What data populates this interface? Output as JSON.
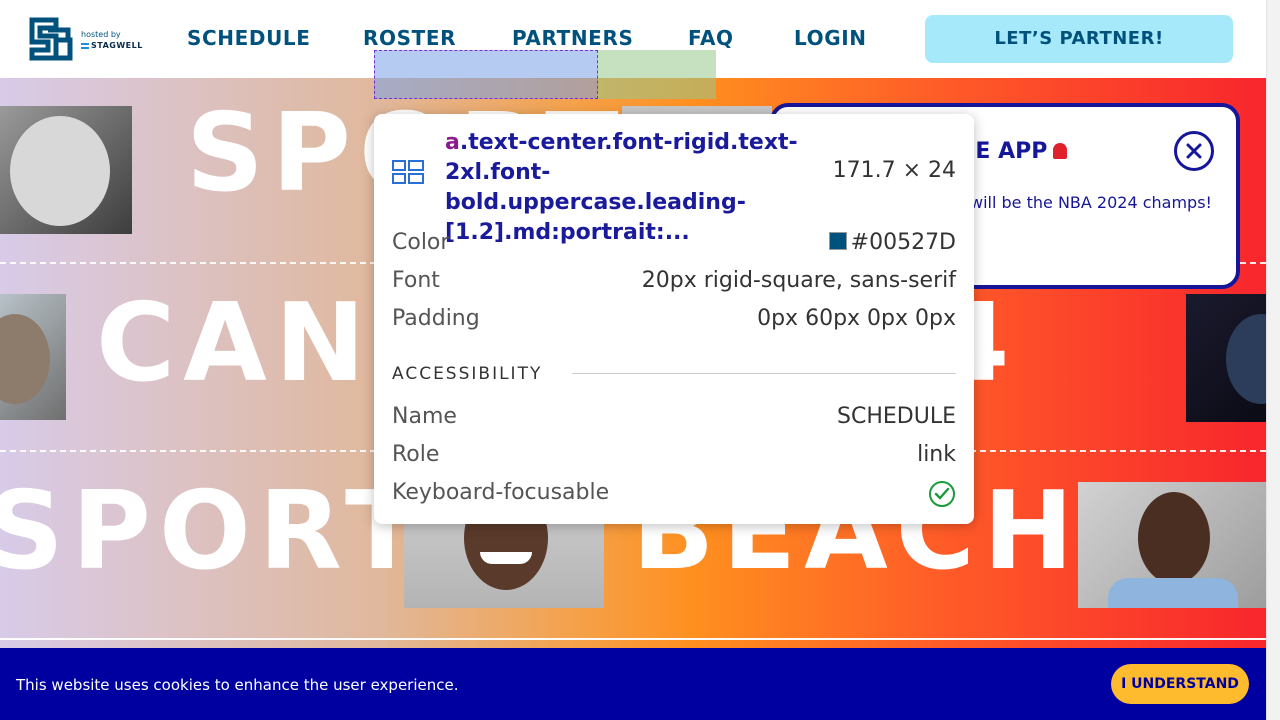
{
  "header": {
    "hosted_by": "hosted by",
    "stagwell": "STAGWELL",
    "nav": {
      "schedule": "SCHEDULE",
      "roster": "ROSTER",
      "partners": "PARTNERS",
      "faq": "FAQ",
      "login": "LOGIN"
    },
    "cta": "LET’S PARTNER!"
  },
  "hero": {
    "row1": "SPORT",
    "row2": "CANNES 2024",
    "row3a": "SPORT",
    "row3b": "BEACH"
  },
  "promo": {
    "title": "HE APP",
    "text": "will be the NBA 2024 champs!",
    "close_icon": "close-icon"
  },
  "tooltip": {
    "tag": "a",
    "selector": ".text-center.font-rigid.text-2xl.font-bold.uppercase.leading-[1.2].md:portrait:...",
    "size": "171.7 × 24",
    "color_label": "Color",
    "color_value": "#00527D",
    "font_label": "Font",
    "font_value": "20px rigid-square, sans-serif",
    "padding_label": "Padding",
    "padding_value": "0px 60px 0px 0px",
    "section": "ACCESSIBILITY",
    "name_label": "Name",
    "name_value": "SCHEDULE",
    "role_label": "Role",
    "role_value": "link",
    "focus_label": "Keyboard-focusable"
  },
  "cookie": {
    "text": "This website uses cookies to enhance the user experience.",
    "button": "I UNDERSTAND"
  },
  "colors": {
    "brand_blue": "#00527D",
    "cta_bg": "#a6e9fb",
    "cookie_bg": "#0000a0",
    "cookie_btn": "#ffbb2e",
    "promo_border": "#16169a"
  }
}
